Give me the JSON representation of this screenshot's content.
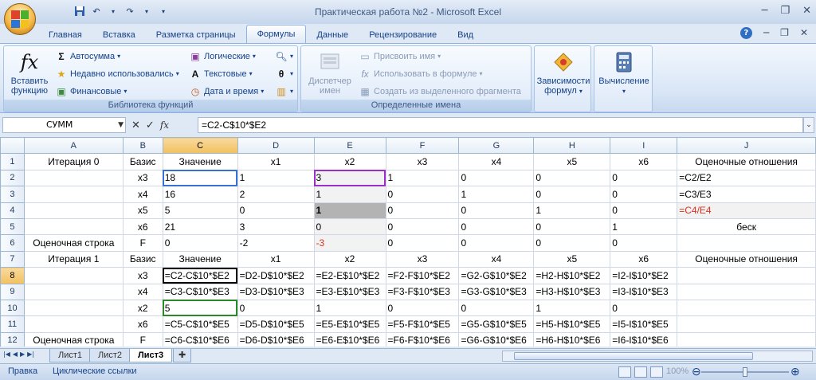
{
  "window": {
    "title": "Практическая работа №2 - Microsoft Excel",
    "minimize": "─",
    "restore": "❐",
    "close": "✕"
  },
  "tabs": [
    {
      "label": "Главная"
    },
    {
      "label": "Вставка"
    },
    {
      "label": "Разметка страницы"
    },
    {
      "label": "Формулы",
      "active": true
    },
    {
      "label": "Данные"
    },
    {
      "label": "Рецензирование"
    },
    {
      "label": "Вид"
    }
  ],
  "ribbon": {
    "library": {
      "label": "Библиотека функций",
      "insert_function": "Вставить функцию",
      "autosum": "Автосумма",
      "recent": "Недавно использовались",
      "financial": "Финансовые",
      "logical": "Логические",
      "text": "Текстовые",
      "datetime": "Дата и время"
    },
    "names": {
      "label": "Определенные имена",
      "manager": "Диспетчер имен",
      "assign": "Присвоить имя",
      "use_in_formula": "Использовать в формуле",
      "create_from_selection": "Создать из выделенного фрагмента"
    },
    "dependencies": {
      "label": "Зависимости формул"
    },
    "calculation": {
      "label": "Вычисление"
    }
  },
  "formula_bar": {
    "name_box": "СУММ",
    "formula": "=C2-C$10*$E2",
    "fx": "fx"
  },
  "columns": [
    "A",
    "B",
    "C",
    "D",
    "E",
    "F",
    "G",
    "H",
    "I",
    "J"
  ],
  "rows": [
    {
      "n": "1",
      "cells": [
        "Итерация 0",
        "Базис",
        "Значение",
        "x1",
        "x2",
        "x3",
        "x4",
        "x5",
        "x6",
        "Оценочные отношения"
      ]
    },
    {
      "n": "2",
      "cells": [
        "",
        "x3",
        "18",
        "1",
        "3",
        "1",
        "0",
        "0",
        "0",
        "=C2/E2"
      ]
    },
    {
      "n": "3",
      "cells": [
        "",
        "x4",
        "16",
        "2",
        "1",
        "0",
        "1",
        "0",
        "0",
        "=C3/E3"
      ]
    },
    {
      "n": "4",
      "cells": [
        "",
        "x5",
        "5",
        "0",
        "1",
        "0",
        "0",
        "1",
        "0",
        "=C4/E4"
      ]
    },
    {
      "n": "5",
      "cells": [
        "",
        "x6",
        "21",
        "3",
        "0",
        "0",
        "0",
        "0",
        "1",
        "беск"
      ]
    },
    {
      "n": "6",
      "cells": [
        "Оценочная строка",
        "F",
        "0",
        "-2",
        "-3",
        "0",
        "0",
        "0",
        "0",
        ""
      ]
    },
    {
      "n": "7",
      "cells": [
        "Итерация 1",
        "Базис",
        "Значение",
        "x1",
        "x2",
        "x3",
        "x4",
        "x5",
        "x6",
        "Оценочные отношения"
      ]
    },
    {
      "n": "8",
      "cells": [
        "",
        "x3",
        "=C2-C$10*$E2",
        "=D2-D$10*$E2",
        "=E2-E$10*$E2",
        "=F2-F$10*$E2",
        "=G2-G$10*$E2",
        "=H2-H$10*$E2",
        "=I2-I$10*$E2",
        ""
      ]
    },
    {
      "n": "9",
      "cells": [
        "",
        "x4",
        "=C3-C$10*$E3",
        "=D3-D$10*$E3",
        "=E3-E$10*$E3",
        "=F3-F$10*$E3",
        "=G3-G$10*$E3",
        "=H3-H$10*$E3",
        "=I3-I$10*$E3",
        ""
      ]
    },
    {
      "n": "10",
      "cells": [
        "",
        "x2",
        "5",
        "0",
        "1",
        "0",
        "0",
        "1",
        "0",
        ""
      ]
    },
    {
      "n": "11",
      "cells": [
        "",
        "x6",
        "=C5-C$10*$E5",
        "=D5-D$10*$E5",
        "=E5-E$10*$E5",
        "=F5-F$10*$E5",
        "=G5-G$10*$E5",
        "=H5-H$10*$E5",
        "=I5-I$10*$E5",
        ""
      ]
    },
    {
      "n": "12",
      "cells": [
        "Оценочная строка",
        "F",
        "=C6-C$10*$E6",
        "=D6-D$10*$E6",
        "=E6-E$10*$E6",
        "=F6-F$10*$E6",
        "=G6-G$10*$E6",
        "=H6-H$10*$E6",
        "=I6-I$10*$E6",
        ""
      ]
    }
  ],
  "sheets": [
    {
      "label": "Лист1"
    },
    {
      "label": "Лист2"
    },
    {
      "label": "Лист3",
      "active": true
    }
  ],
  "status": {
    "mode": "Правка",
    "circular": "Циклические ссылки",
    "zoom": "100%"
  },
  "colors": {
    "ref_green": "#2a8a2a",
    "ref_purple": "#9b30c8",
    "neg_red": "#e0301e",
    "active_tab": "#8db2e3"
  }
}
